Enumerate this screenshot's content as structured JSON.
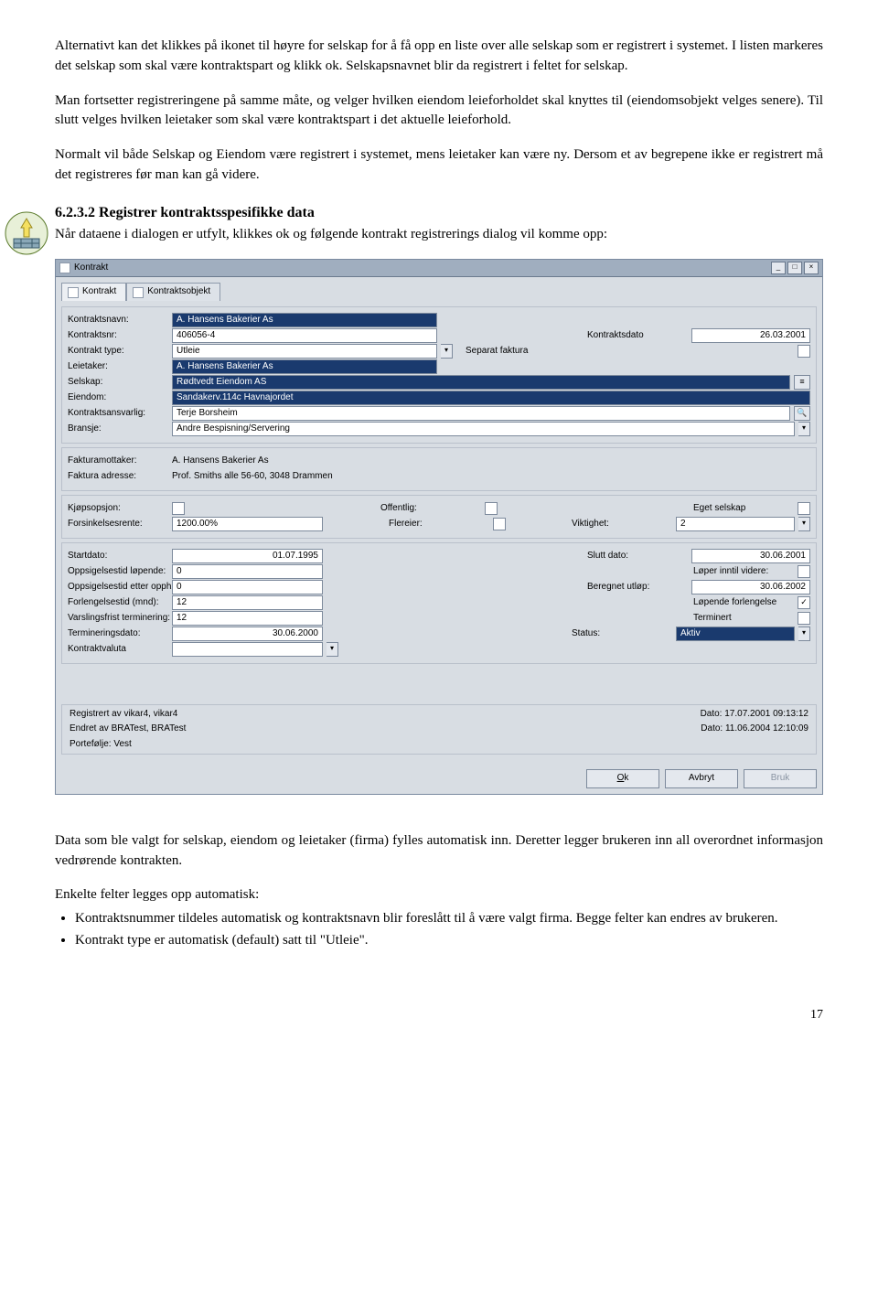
{
  "para1": "Alternativt kan det klikkes på ikonet til høyre for selskap for å få opp en liste over alle selskap som er registrert i systemet. I listen markeres det selskap som skal være kontraktspart og klikk ok. Selskapsnavnet blir da registrert i feltet for selskap.",
  "para2": "Man fortsetter registreringene på samme måte, og velger hvilken eiendom leieforholdet skal knyttes til (eiendomsobjekt velges senere). Til slutt velges hvilken leietaker som skal være kontraktspart i det aktuelle leieforhold.",
  "para3": "Normalt vil både Selskap og Eiendom være registrert i systemet, mens leietaker kan være ny. Dersom et av begrepene ikke er registrert må det registreres før man kan gå videre.",
  "section_num": "6.2.3.2 Registrer kontraktsspesifikke data",
  "section_text": "Når dataene i dialogen er utfylt, klikkes ok og følgende kontrakt registrerings dialog vil komme opp:",
  "para4": "Data som ble valgt for selskap, eiendom og leietaker (firma) fylles automatisk inn. Deretter legger brukeren inn all overordnet informasjon vedrørende kontrakten.",
  "para5": "Enkelte felter legges opp automatisk:",
  "bullet1": "Kontraktsnummer tildeles automatisk og kontraktsnavn blir foreslått til å være valgt firma. Begge felter kan endres av brukeren.",
  "bullet2": "Kontrakt type er automatisk (default) satt til \"Utleie\".",
  "pagenum": "17",
  "win": {
    "title": "Kontrakt",
    "tabs": {
      "t1": "Kontrakt",
      "t2": "Kontraktsobjekt"
    },
    "labels": {
      "kontraktsnavn": "Kontraktsnavn:",
      "kontraktsnr": "Kontraktsnr:",
      "kontrakttype": "Kontrakt type:",
      "leietaker": "Leietaker:",
      "selskap": "Selskap:",
      "eiendom": "Eiendom:",
      "kontraktsansvarlig": "Kontraktsansvarlig:",
      "bransje": "Bransje:",
      "kontraktsdato": "Kontraktsdato",
      "separatfaktura": "Separat faktura",
      "fakturamottaker": "Fakturamottaker:",
      "fakturaadresse": "Faktura adresse:",
      "kjopsopsjon": "Kjøpsopsjon:",
      "offentlig": "Offentlig:",
      "egetselskap": "Eget selskap",
      "forsinkelsesrente": "Forsinkelsesrente:",
      "fleireier": "Flereier:",
      "viktighet": "Viktighet:",
      "startdato": "Startdato:",
      "sluttdato": "Slutt dato:",
      "oppsigelsestidlopende": "Oppsigelsestid løpende:",
      "loperinntil": "Løper inntil videre:",
      "oppsigelsestidetter": "Oppsigelsestid etter opphør:",
      "beregnetutlop": "Beregnet utløp:",
      "forlengelsestid": "Forlengelsestid (mnd):",
      "lopendeforlengelse": "Løpende forlengelse",
      "varslingsfrist": "Varslingsfrist terminering:",
      "terminert": "Terminert",
      "termineringsdato": "Termineringsdato:",
      "status": "Status:",
      "kontraktvaluta": "Kontraktvaluta"
    },
    "vals": {
      "kontraktsnavn": "A. Hansens Bakerier As",
      "kontraktsnr": "406056-4",
      "kontrakttype": "Utleie",
      "kontraktsdato": "26.03.2001",
      "leietaker": "A. Hansens Bakerier As",
      "selskap": "Rødtvedt Eiendom AS",
      "eiendom": "Sandakerv.114c Havnajordet",
      "kontraktsansvarlig": "Terje Borsheim",
      "bransje": "Andre Bespisning/Servering",
      "fakturamottaker": "A. Hansens Bakerier As",
      "fakturaadresse": "Prof. Smiths alle 56-60, 3048 Drammen",
      "forsinkelsesrente": "1200.00%",
      "viktighet": "2",
      "startdato": "01.07.1995",
      "sluttdato": "30.06.2001",
      "oppsigelsestidlopende": "0",
      "oppsigelsestidetter": "0",
      "beregnetutlop": "30.06.2002",
      "forlengelsestid": "12",
      "varslingsfrist": "12",
      "termineringsdato": "30.06.2000",
      "status": "Aktiv"
    },
    "footer": {
      "reg": "Registrert av vikar4, vikar4",
      "regdate": "Dato: 17.07.2001 09:13:12",
      "endret": "Endret av BRATest, BRATest",
      "endretdate": "Dato: 11.06.2004 12:10:09",
      "portefolje": "Portefølje: Vest"
    },
    "buttons": {
      "ok": "Ok",
      "avbryt": "Avbryt",
      "bruk": "Bruk"
    }
  }
}
